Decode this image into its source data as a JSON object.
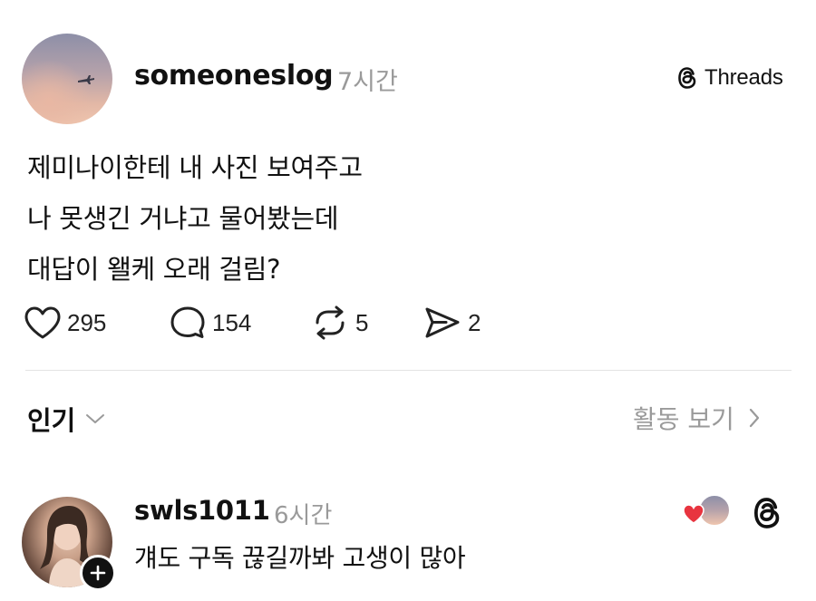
{
  "post": {
    "username": "someoneslog",
    "time": "7시간",
    "brand": "Threads",
    "lines": [
      "제미나이한테 내 사진 보여주고",
      "나 못생긴 거냐고 물어봤는데",
      "대답이 왤케 오래 걸림?"
    ],
    "likes": "295",
    "replies": "154",
    "reposts": "5",
    "shares": "2"
  },
  "sort": {
    "label": "인기",
    "activity_label": "활동 보기"
  },
  "comment": {
    "username": "swls1011",
    "time": "6시간",
    "text": "걔도 구독 끊길까봐 고생이 많아"
  },
  "colors": {
    "text": "#111111",
    "muted": "#9a9a9a",
    "heart": "#e8343f",
    "divider": "#e3e3e3"
  },
  "icons": [
    "heart-icon",
    "comment-icon",
    "repost-icon",
    "share-icon",
    "threads-logo-icon",
    "chevron-down-icon",
    "chevron-right-icon",
    "plus-icon"
  ]
}
